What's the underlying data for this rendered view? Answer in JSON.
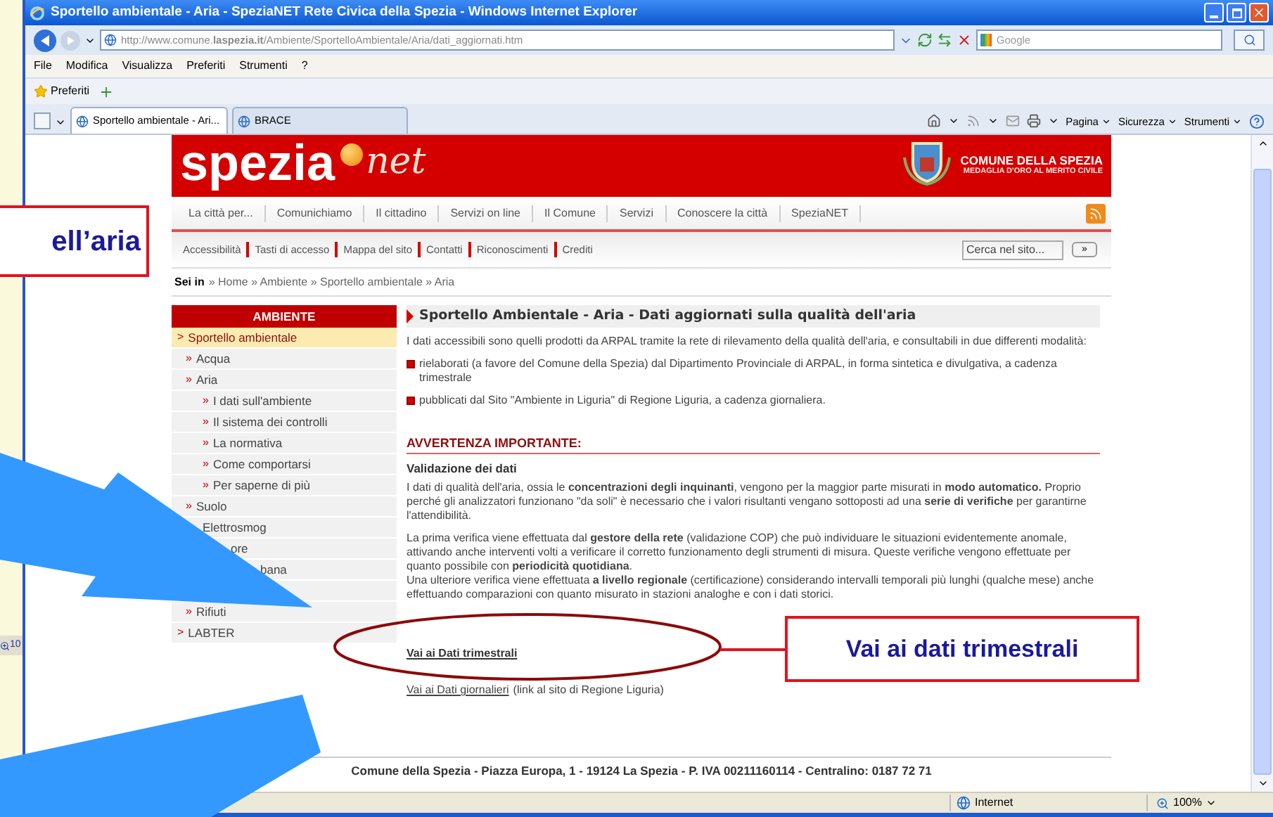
{
  "window": {
    "title": "Sportello ambientale - Aria - SpeziaNET Rete Civica della Spezia - Windows Internet Explorer"
  },
  "address_bar": {
    "url": "http://www.comune.**laspezia.it**/Ambiente/SportelloAmbientale/Aria/dati_aggiornati.htm",
    "search_placeholder": "Google"
  },
  "menu": [
    "File",
    "Modifica",
    "Visualizza",
    "Preferiti",
    "Strumenti",
    "?"
  ],
  "favorites": {
    "label": "Preferiti"
  },
  "tabs": [
    {
      "label": "Sportello ambientale - Ari...",
      "selected": true
    },
    {
      "label": "BRACE",
      "selected": false
    }
  ],
  "command_bar": [
    "Pagina",
    "Sicurezza",
    "Strumenti"
  ],
  "site": {
    "logo_main": "spezia",
    "logo_suffix": "net",
    "org_name": "COMUNE DELLA SPEZIA",
    "org_subtitle": "MEDAGLIA D'ORO AL MERITO CIVILE",
    "nav": [
      "La città per...",
      "Comunichiamo",
      "Il cittadino",
      "Servizi on line",
      "Il Comune",
      "Servizi",
      "Conoscere la città",
      "SpeziaNET"
    ],
    "utility_links": [
      "Accessibilità",
      "Tasti di accesso",
      "Mappa del sito",
      "Contatti",
      "Riconoscimenti",
      "Crediti"
    ],
    "search_placeholder": "Cerca nel sito...",
    "search_button": "»",
    "breadcrumb": {
      "label": "Sei in",
      "path": "» Home » Ambiente » Sportello ambientale » Aria"
    },
    "sidebar": {
      "title": "AMBIENTE",
      "items": [
        {
          "label": "Sportello ambientale",
          "marker": ">",
          "selected": true,
          "children": [
            {
              "label": "Acqua",
              "marker": "»",
              "selected": false
            },
            {
              "label": "Aria",
              "marker": "»",
              "selected": false,
              "children": [
                {
                  "label": "I dati sull'ambiente",
                  "marker": "»",
                  "selected": false
                },
                {
                  "label": "Il sistema dei controlli",
                  "marker": "»",
                  "selected": false
                },
                {
                  "label": "La normativa",
                  "marker": "»",
                  "selected": false
                },
                {
                  "label": "Come comportarsi",
                  "marker": "»",
                  "selected": false
                },
                {
                  "label": "Per saperne di più",
                  "marker": "»",
                  "selected": false
                }
              ]
            },
            {
              "label": "Suolo",
              "marker": "»",
              "selected": false
            },
            {
              "label": "Elettrosmog",
              "kind": "fragment",
              "selected": false
            },
            {
              "label": "ore",
              "kind": "fragment",
              "selected": false
            },
            {
              "label": "bana",
              "kind": "fragment",
              "selected": false
            },
            {
              "label": "Rifiuti",
              "marker": "»",
              "selected": false
            }
          ]
        },
        {
          "label": "LABTER",
          "marker": ">",
          "selected": false
        }
      ]
    },
    "article": {
      "title": "Sportello Ambientale - Aria - Dati aggiornati sulla qualità dell'aria",
      "intro": "I dati accessibili sono quelli prodotti da ARPAL tramite la rete di rilevamento della qualità dell'aria, e consultabili in due differenti modalità:",
      "bullets": [
        "rielaborati (a favore del Comune della Spezia) dal Dipartimento Provinciale di ARPAL, in forma sintetica e divulgativa, a cadenza trimestrale",
        "pubblicati dal Sito \"Ambiente in Liguria\" di Regione Liguria, a cadenza giornaliera."
      ],
      "warning": "AVVERTENZA IMPORTANTE:",
      "subheading": "Validazione dei dati",
      "paragraphs": [
        "I dati di qualità dell'aria, ossia le **concentrazioni degli inquinanti**, vengono per la maggior parte misurati in **modo automatico.** Proprio perché gli analizzatori funzionano \"da soli\" è necessario che i valori risultanti vengano sottoposti ad una **serie di verifiche** per garantirne l'attendibilità.",
        "La prima verifica viene effettuata dal **gestore della rete** (validazione COP) che può individuare le situazioni evidentemente anomale, attivando anche interventi volti a verificare il corretto funzionamento degli strumenti di misura. Queste verifiche vengono effettuate per quanto possibile con **periodicità quotidiana**.",
        "Una ulteriore verifica viene effettuata **a livello regionale** (certificazione) considerando intervalli temporali più lunghi (qualche mese) anche effettuando comparazioni con quanto misurato in stazioni analoghe e con i dati storici."
      ],
      "link_primary": "Vai ai Dati trimestrali",
      "link_secondary": "Vai ai Dati giornalieri",
      "link_secondary_note": "(link al sito di Regione Liguria)"
    },
    "footer": "Comune della Spezia - Piazza Europa, 1 - 19124 La Spezia - P. IVA 00211160114 - Centralino: 0187 72 71"
  },
  "status_bar": {
    "zone": "Internet",
    "zoom": "100%"
  },
  "background_window": {
    "zoom_fragment": "10"
  },
  "annotations": {
    "callout_left": "ell’aria",
    "callout_right": "Vai ai dati trimestrali"
  }
}
